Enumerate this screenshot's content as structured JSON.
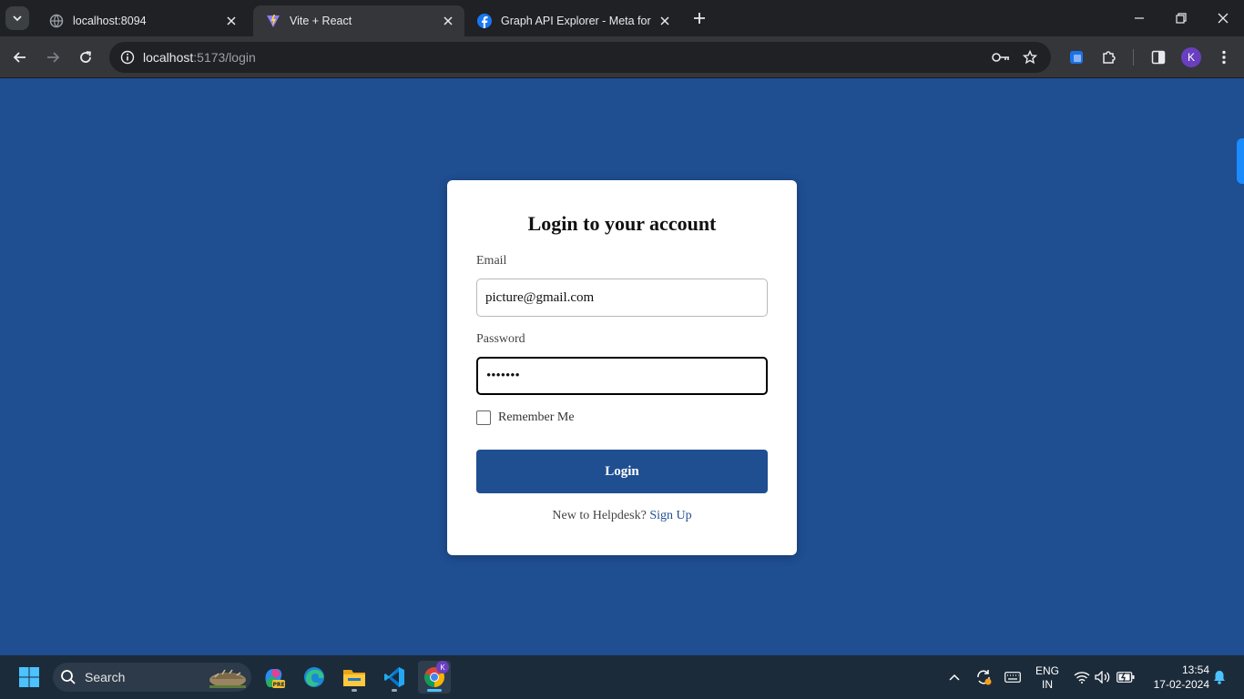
{
  "browser": {
    "tabs": [
      {
        "title": "localhost:8094",
        "active": false
      },
      {
        "title": "Vite + React",
        "active": true
      },
      {
        "title": "Graph API Explorer - Meta for Developers",
        "active": false
      }
    ],
    "url": {
      "host": "localhost",
      "path": ":5173/login"
    },
    "profile_initial": "K"
  },
  "login": {
    "heading": "Login to your account",
    "email_label": "Email",
    "email_value": "picture@gmail.com",
    "password_label": "Password",
    "password_value": "•••••••",
    "remember_label": "Remember Me",
    "login_button": "Login",
    "signup_prompt": "New to Helpdesk?",
    "signup_link": "Sign Up"
  },
  "colors": {
    "page_bg": "#1f4e91",
    "button_bg": "#1f4e91",
    "card_bg": "#ffffff"
  },
  "taskbar": {
    "search_placeholder": "Search",
    "language": "ENG",
    "region": "IN",
    "time": "13:54",
    "date": "17-02-2024",
    "apps": [
      "start-icon",
      "copilot-icon",
      "edge-icon",
      "file-explorer-icon",
      "vscode-icon",
      "chrome-icon"
    ]
  }
}
